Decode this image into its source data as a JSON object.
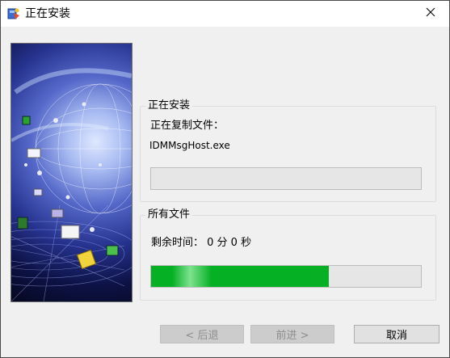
{
  "window": {
    "title": "正在安装",
    "app_icon": "installer-icon",
    "close_icon": "close-icon"
  },
  "banner": {
    "image": "globe-network-artwork"
  },
  "current_group": {
    "legend": "正在安装",
    "copying_label": "正在复制文件：",
    "file_name": "IDMMsgHost.exe",
    "progress": 0
  },
  "all_files_group": {
    "legend": "所有文件",
    "time_remaining": "剩余时间： 0 分 0 秒",
    "progress": 0.66,
    "progress_color": "#06b025"
  },
  "buttons": {
    "back": "< 后退",
    "next": "前进 >",
    "cancel": "取消"
  }
}
